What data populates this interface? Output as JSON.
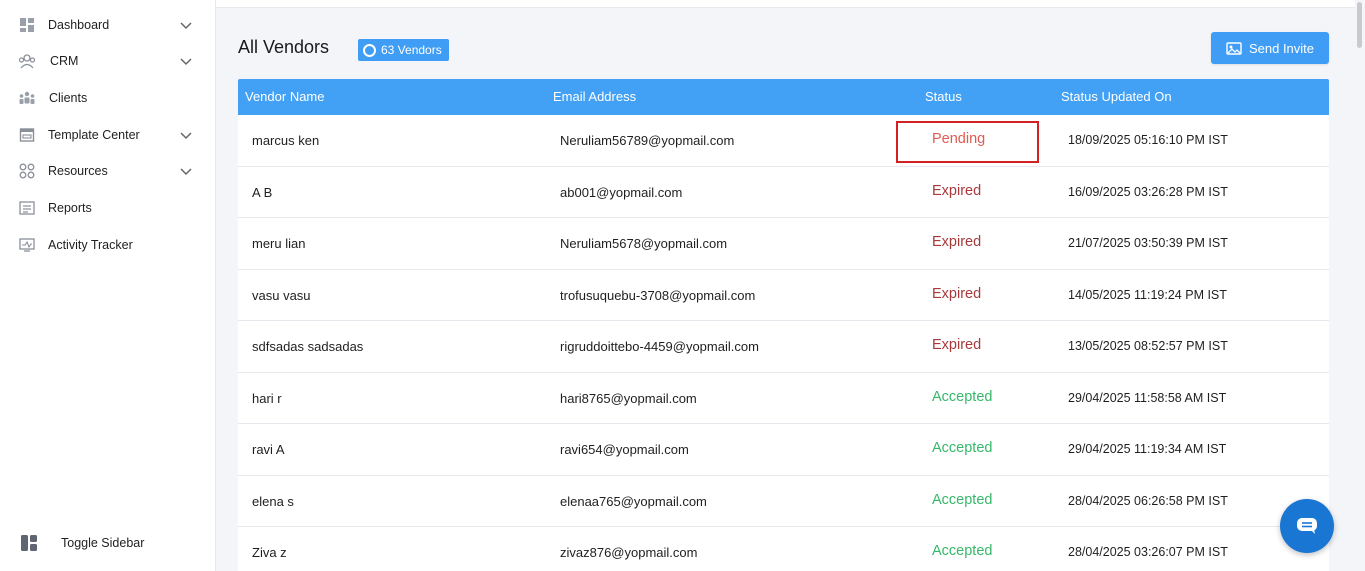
{
  "sidebar": {
    "items": [
      {
        "label": "Dashboard",
        "icon": "dashboard-icon",
        "chevron": true
      },
      {
        "label": "CRM",
        "icon": "crm-icon",
        "chevron": true
      },
      {
        "label": "Clients",
        "icon": "clients-icon",
        "chevron": false
      },
      {
        "label": "Template Center",
        "icon": "template-icon",
        "chevron": true
      },
      {
        "label": "Resources",
        "icon": "resources-icon",
        "chevron": true
      },
      {
        "label": "Reports",
        "icon": "reports-icon",
        "chevron": false
      },
      {
        "label": "Activity Tracker",
        "icon": "activity-icon",
        "chevron": false
      }
    ],
    "toggle_label": "Toggle Sidebar"
  },
  "header": {
    "title": "All Vendors",
    "count_badge": "63 Vendors",
    "send_invite_label": "Send Invite"
  },
  "table": {
    "columns": [
      "Vendor Name",
      "Email Address",
      "Status",
      "Status Updated On"
    ],
    "rows": [
      {
        "name": "marcus ken",
        "email": "Neruliam56789@yopmail.com",
        "status": "Pending",
        "updated": "18/09/2025 05:16:10 PM IST"
      },
      {
        "name": "A B",
        "email": "ab001@yopmail.com",
        "status": "Expired",
        "updated": "16/09/2025 03:26:28 PM IST"
      },
      {
        "name": "meru lian",
        "email": "Neruliam5678@yopmail.com",
        "status": "Expired",
        "updated": "21/07/2025 03:50:39 PM IST"
      },
      {
        "name": "vasu vasu",
        "email": "trofusuquebu-3708@yopmail.com",
        "status": "Expired",
        "updated": "14/05/2025 11:19:24 PM IST"
      },
      {
        "name": "sdfsadas sadsadas",
        "email": "rigruddoittebo-4459@yopmail.com",
        "status": "Expired",
        "updated": "13/05/2025 08:52:57 PM IST"
      },
      {
        "name": "hari r",
        "email": "hari8765@yopmail.com",
        "status": "Accepted",
        "updated": "29/04/2025 11:58:58 AM IST"
      },
      {
        "name": "ravi A",
        "email": "ravi654@yopmail.com",
        "status": "Accepted",
        "updated": "29/04/2025 11:19:34 AM IST"
      },
      {
        "name": "elena s",
        "email": "elenaa765@yopmail.com",
        "status": "Accepted",
        "updated": "28/04/2025 06:26:58 PM IST"
      },
      {
        "name": "Ziva z",
        "email": "zivaz876@yopmail.com",
        "status": "Accepted",
        "updated": "28/04/2025 03:26:07 PM IST"
      }
    ]
  },
  "colors": {
    "accent": "#42a0f5",
    "pending": "#e05a52",
    "expired": "#a8393b",
    "accepted": "#36b86a",
    "highlight_box": "#d32020"
  }
}
